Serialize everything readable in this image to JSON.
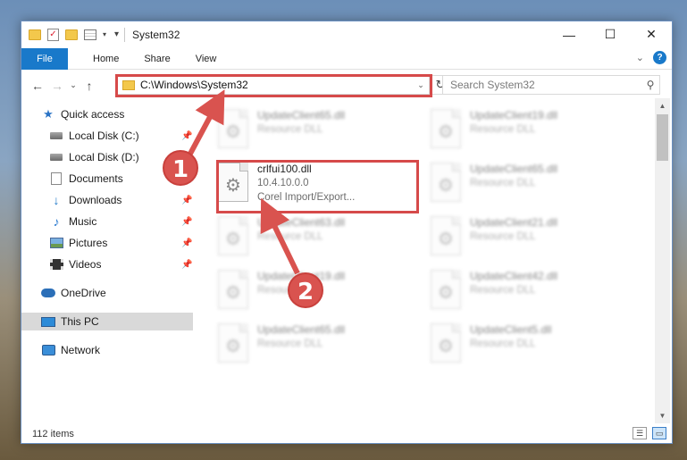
{
  "window": {
    "title": "System32",
    "minimize_glyph": "—",
    "maximize_glyph": "☐",
    "close_glyph": "✕"
  },
  "ribbon": {
    "file": "File",
    "tabs": [
      "Home",
      "Share",
      "View"
    ]
  },
  "nav": {
    "address": "C:\\Windows\\System32",
    "search_placeholder": "Search System32"
  },
  "sidebar": {
    "items": [
      {
        "label": "Quick access",
        "icon": "star-icon"
      },
      {
        "label": "Local Disk (C:)",
        "icon": "drive-icon",
        "pinned": true
      },
      {
        "label": "Local Disk (D:)",
        "icon": "drive-icon"
      },
      {
        "label": "Documents",
        "icon": "documents-icon"
      },
      {
        "label": "Downloads",
        "icon": "downloads-icon",
        "pinned": true
      },
      {
        "label": "Music",
        "icon": "music-icon",
        "pinned": true
      },
      {
        "label": "Pictures",
        "icon": "pictures-icon",
        "pinned": true
      },
      {
        "label": "Videos",
        "icon": "videos-icon",
        "pinned": true
      },
      {
        "label": "OneDrive",
        "icon": "onedrive-icon"
      },
      {
        "label": "This PC",
        "icon": "computer-icon",
        "selected": true
      },
      {
        "label": "Network",
        "icon": "network-icon"
      }
    ]
  },
  "files": {
    "highlighted": {
      "name": "crlfui100.dll",
      "version": "10.4.10.0.0",
      "description": "Corel Import/Export..."
    },
    "blurred": [
      {
        "name": "UpdateClient65.dll",
        "type": "Resource DLL"
      },
      {
        "name": "UpdateClient19.dll",
        "type": "Resource DLL"
      },
      {
        "name": "UpdateClient65.dll",
        "type": "Resource DLL"
      },
      {
        "name": "UpdateClient63.dll",
        "type": "Resource DLL"
      },
      {
        "name": "UpdateClient21.dll",
        "type": "Resource DLL"
      },
      {
        "name": "UpdateClient19.dll",
        "type": "Resource DLL"
      },
      {
        "name": "UpdateClient42.dll",
        "type": "Resource DLL"
      },
      {
        "name": "UpdateClient65.dll",
        "type": "Resource DLL"
      },
      {
        "name": "UpdateClient5.dll",
        "type": "Resource DLL"
      }
    ]
  },
  "status": {
    "count": "112 items"
  },
  "annotations": {
    "step1": "1",
    "step2": "2",
    "color": "#d9534f"
  }
}
